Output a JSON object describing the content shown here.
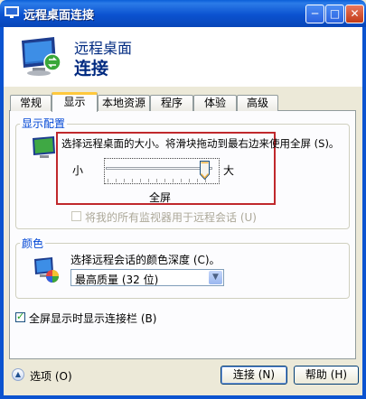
{
  "window": {
    "title": "远程桌面连接"
  },
  "banner": {
    "line1": "远程桌面",
    "line2": "连接"
  },
  "tabs": [
    {
      "label": "常规",
      "active": false
    },
    {
      "label": "显示",
      "active": true
    },
    {
      "label": "本地资源",
      "active": false
    },
    {
      "label": "程序",
      "active": false
    },
    {
      "label": "体验",
      "active": false
    },
    {
      "label": "高级",
      "active": false
    }
  ],
  "display_config": {
    "group_label": "显示配置",
    "size_prompt": "选择远程桌面的大小。将滑块拖动到最右边来使用全屏 (S)。",
    "slider_min_label": "小",
    "slider_max_label": "大",
    "slider_value_label": "全屏",
    "slider_level": 1.0,
    "multi_monitor_label": "将我的所有监视器用于远程会话 (U)",
    "multi_monitor_checked": false
  },
  "colors": {
    "group_label": "颜色",
    "prompt": "选择远程会话的颜色深度 (C)。",
    "selected_depth": "最高质量 (32 位)"
  },
  "fullscreen_bar": {
    "label": "全屏显示时显示连接栏 (B)",
    "checked": true
  },
  "footer": {
    "options_label": "选项 (O)",
    "connect_label": "连接 (N)",
    "help_label": "帮助 (H)"
  },
  "colors_theme": {
    "title_bar": "#0b53d0",
    "group_label": "#0046d5",
    "highlight": "#c0282c"
  }
}
